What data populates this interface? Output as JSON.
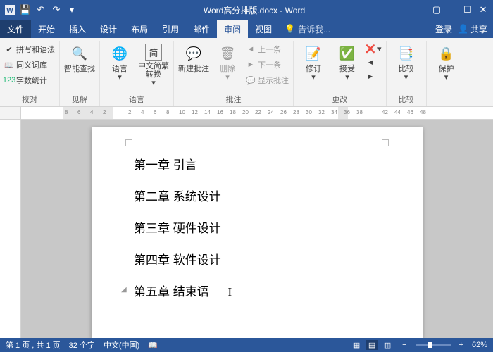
{
  "title": "Word高分排版.docx - Word",
  "menu": {
    "file": "文件",
    "items": [
      "开始",
      "插入",
      "设计",
      "布局",
      "引用",
      "邮件",
      "审阅",
      "视图"
    ],
    "active": "审阅",
    "tell_me": "告诉我...",
    "login": "登录",
    "share": "共享"
  },
  "ribbon": {
    "proofing": {
      "spell": "拼写和语法",
      "thesaurus": "同义词库",
      "wordcount": "字数统计",
      "label": "校对"
    },
    "search": {
      "btn": "智能查找",
      "label": "见解"
    },
    "lang": {
      "btn": "语言"
    },
    "cn": {
      "btn": "中文简繁转换"
    },
    "comment": {
      "new": "新建批注",
      "delete": "删除",
      "prev": "上一条",
      "next": "下一条",
      "show": "显示批注",
      "label": "批注"
    },
    "track": {
      "btn": "修订"
    },
    "accept": {
      "btn": "接受"
    },
    "changes_label": "更改",
    "compare": {
      "btn": "比较",
      "label": "比较"
    },
    "protect": {
      "btn": "保护"
    }
  },
  "ruler": [
    "8",
    "6",
    "4",
    "2",
    "",
    "2",
    "4",
    "6",
    "8",
    "10",
    "12",
    "14",
    "16",
    "18",
    "20",
    "22",
    "24",
    "26",
    "28",
    "30",
    "32",
    "34",
    "36",
    "38",
    "",
    "42",
    "44",
    "46",
    "48"
  ],
  "doc": [
    "第一章 引言",
    "第二章 系统设计",
    "第三章 硬件设计",
    "第四章 软件设计",
    "第五章 结束语"
  ],
  "status": {
    "page": "第 1 页 , 共 1 页",
    "words": "32 个字",
    "lang": "中文(中国)",
    "zoom": "62%"
  }
}
